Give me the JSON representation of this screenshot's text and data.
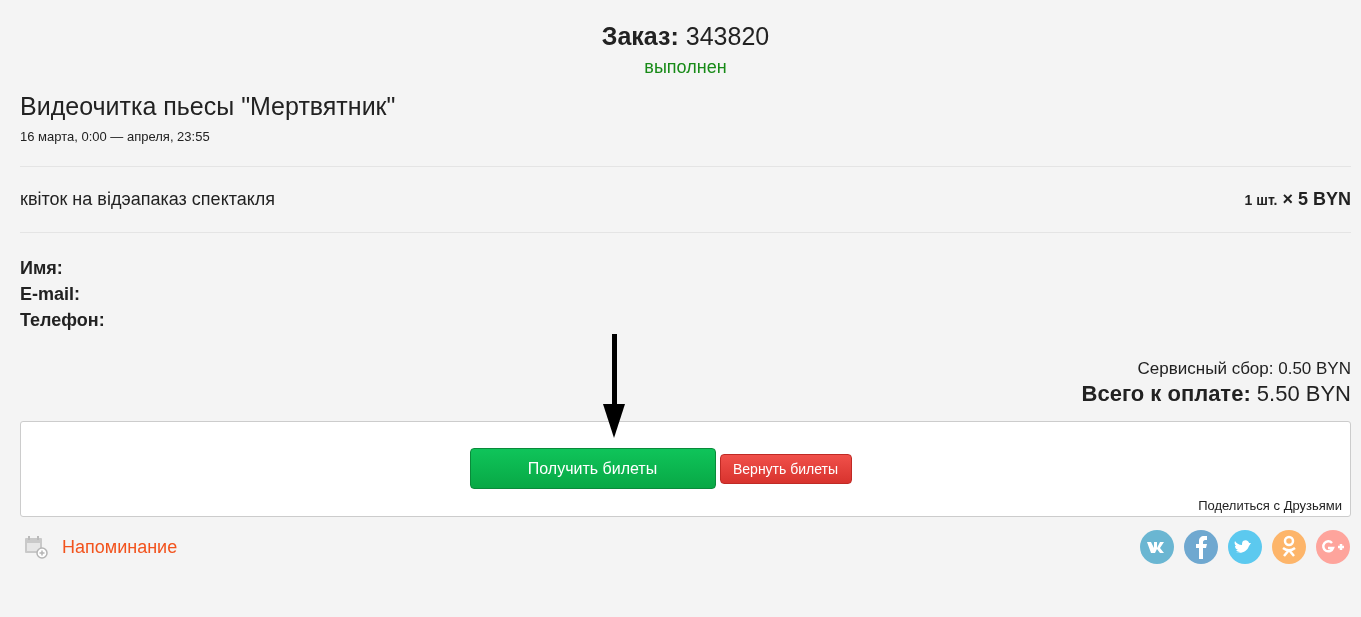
{
  "order": {
    "label": "Заказ:",
    "number": "343820",
    "status": "выполнен"
  },
  "event": {
    "title": "Видеочитка пьесы \"Мертвятник\"",
    "dates": "16 марта, 0:00 — апреля, 23:55"
  },
  "ticket": {
    "name": "квіток на відэапаказ спектакля",
    "quantity": "1 шт.",
    "price": "× 5 BYN"
  },
  "customer_fields": [
    "Имя:",
    "E-mail:",
    "Телефон:"
  ],
  "fee": "Сервисный сбор: 0.50 BYN",
  "total": {
    "label": "Всего к оплате:",
    "amount": "5.50 BYN"
  },
  "actions": [
    {
      "label": "Получить билеты",
      "kind": "primary"
    },
    {
      "label": "Вернуть билеты",
      "kind": "danger"
    }
  ],
  "share_label": "Поделиться с Друзьями",
  "reminder": "Напоминание",
  "share_buttons": [
    {
      "kind": "vk",
      "color": "#6ab6d2"
    },
    {
      "kind": "facebook",
      "color": "#6fa8d0"
    },
    {
      "kind": "twitter",
      "color": "#5cc9ef"
    },
    {
      "kind": "ok",
      "color": "#fdb56a"
    },
    {
      "kind": "gplus",
      "color": "#fea49c"
    }
  ]
}
